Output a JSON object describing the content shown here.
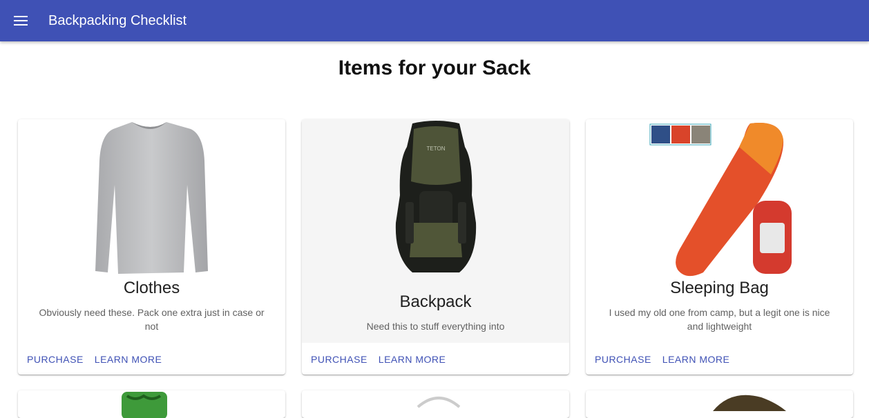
{
  "appbar": {
    "title": "Backpacking Checklist",
    "color": "#3f51b5"
  },
  "page": {
    "heading": "Items for your Sack"
  },
  "cards": [
    {
      "title": "Clothes",
      "description": "Obviously need these. Pack one extra just in case or not",
      "image_icon": "shirt-image",
      "purchase_label": "PURCHASE",
      "learn_label": "LEARN MORE"
    },
    {
      "title": "Backpack",
      "description": "Need this to stuff everything into",
      "image_icon": "backpack-image",
      "purchase_label": "PURCHASE",
      "learn_label": "LEARN MORE"
    },
    {
      "title": "Sleeping Bag",
      "description": "I used my old one from camp, but a legit one is nice and lightweight",
      "image_icon": "sleeping-bag-image",
      "purchase_label": "PURCHASE",
      "learn_label": "LEARN MORE"
    }
  ],
  "partial_cards": [
    {
      "image_icon": "sleeping-pad-image"
    },
    {
      "image_icon": "cookware-image"
    },
    {
      "image_icon": "hat-image"
    }
  ]
}
